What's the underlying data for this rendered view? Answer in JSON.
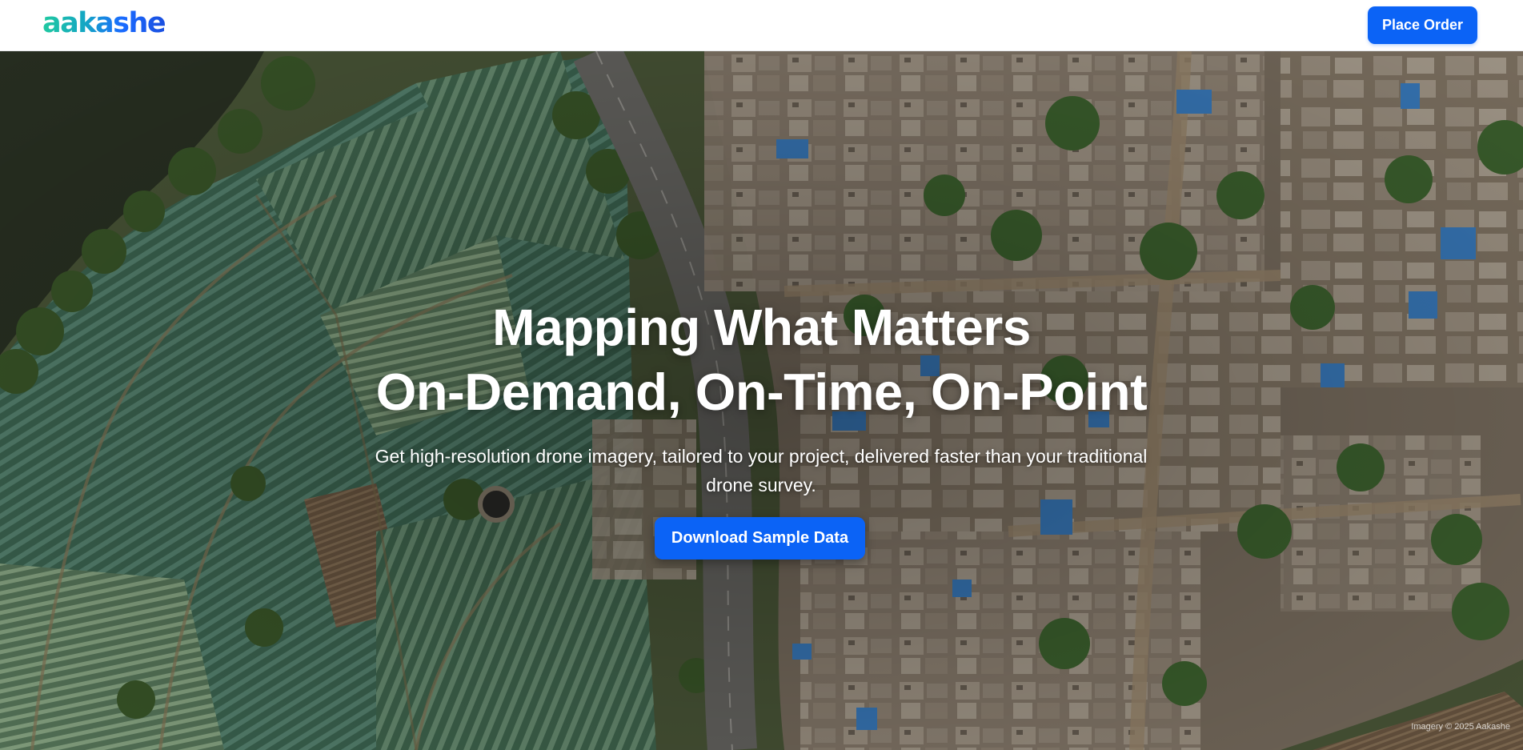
{
  "brand": {
    "logo_text": "aakashe"
  },
  "nav": {
    "order_button_label": "Place Order"
  },
  "hero": {
    "headline_line1": "Mapping What Matters",
    "headline_line2": "On-Demand, On-Time, On-Point",
    "subtitle": "Get high-resolution drone imagery, tailored to your project, delivered faster than your traditional drone survey.",
    "cta_label": "Download Sample Data",
    "image_credit": "Imagery © 2025 Aakashe",
    "background_image": "aerial-drone-photo-village-farmland"
  },
  "colors": {
    "primary": "#0b63f6",
    "logo_gradient_start": "#20c9a0",
    "logo_gradient_end": "#1a4fe0",
    "navbar_bg": "#ffffff"
  }
}
